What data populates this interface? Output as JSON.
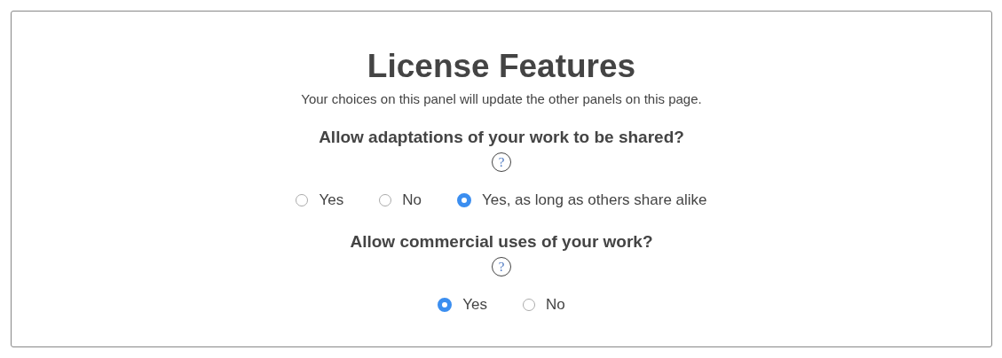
{
  "panel": {
    "title": "License Features",
    "subtitle": "Your choices on this panel will update the other panels on this page."
  },
  "questions": [
    {
      "label": "Allow adaptations of your work to be shared?",
      "help": "?",
      "options": [
        {
          "label": "Yes",
          "selected": false
        },
        {
          "label": "No",
          "selected": false
        },
        {
          "label": "Yes, as long as others share alike",
          "selected": true
        }
      ]
    },
    {
      "label": "Allow commercial uses of your work?",
      "help": "?",
      "options": [
        {
          "label": "Yes",
          "selected": true
        },
        {
          "label": "No",
          "selected": false
        }
      ]
    }
  ]
}
